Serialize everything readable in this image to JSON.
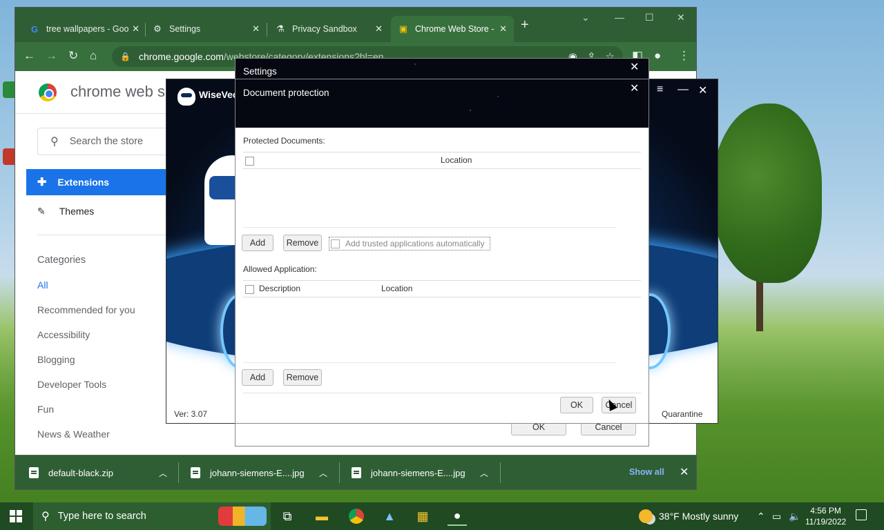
{
  "browser": {
    "tabs": [
      {
        "label": "tree wallpapers - Goo",
        "favicon": "google-icon"
      },
      {
        "label": "Settings",
        "favicon": "gear-icon"
      },
      {
        "label": "Privacy Sandbox",
        "favicon": "flask-icon"
      },
      {
        "label": "Chrome Web Store -",
        "favicon": "web-store-icon",
        "active": true
      }
    ],
    "url_host": "chrome.google.com",
    "url_path": "/webstore/category/extensions?hl=en"
  },
  "webstore": {
    "title": "chrome web s",
    "search_placeholder": "Search the store",
    "nav": {
      "extensions": "Extensions",
      "themes": "Themes"
    },
    "categories_heading": "Categories",
    "categories": [
      "All",
      "Recommended for you",
      "Accessibility",
      "Blogging",
      "Developer Tools",
      "Fun",
      "News & Weather"
    ]
  },
  "downloads": {
    "items": [
      "default-black.zip",
      "johann-siemens-E....jpg",
      "johann-siemens-E....jpg"
    ],
    "show_all": "Show all"
  },
  "wisevector": {
    "name": "WiseVec",
    "version": "Ver: 3.07",
    "quarantine": "Quarantine",
    "partial": "s"
  },
  "settings": {
    "title": "Settings",
    "ok": "OK",
    "cancel": "Cancel"
  },
  "doc_protection": {
    "title": "Document protection",
    "protected_label": "Protected Documents:",
    "protected_col_location": "Location",
    "add": "Add",
    "remove": "Remove",
    "trusted_auto": "Add trusted applications automatically",
    "allowed_label": "Allowed Application:",
    "allowed_col_description": "Description",
    "allowed_col_location": "Location",
    "add2": "Add",
    "remove2": "Remove",
    "ok": "OK",
    "cancel": "Cancel"
  },
  "taskbar": {
    "search_placeholder": "Type here to search",
    "weather": "38°F  Mostly sunny",
    "time": "4:56 PM",
    "date": "11/19/2022"
  }
}
